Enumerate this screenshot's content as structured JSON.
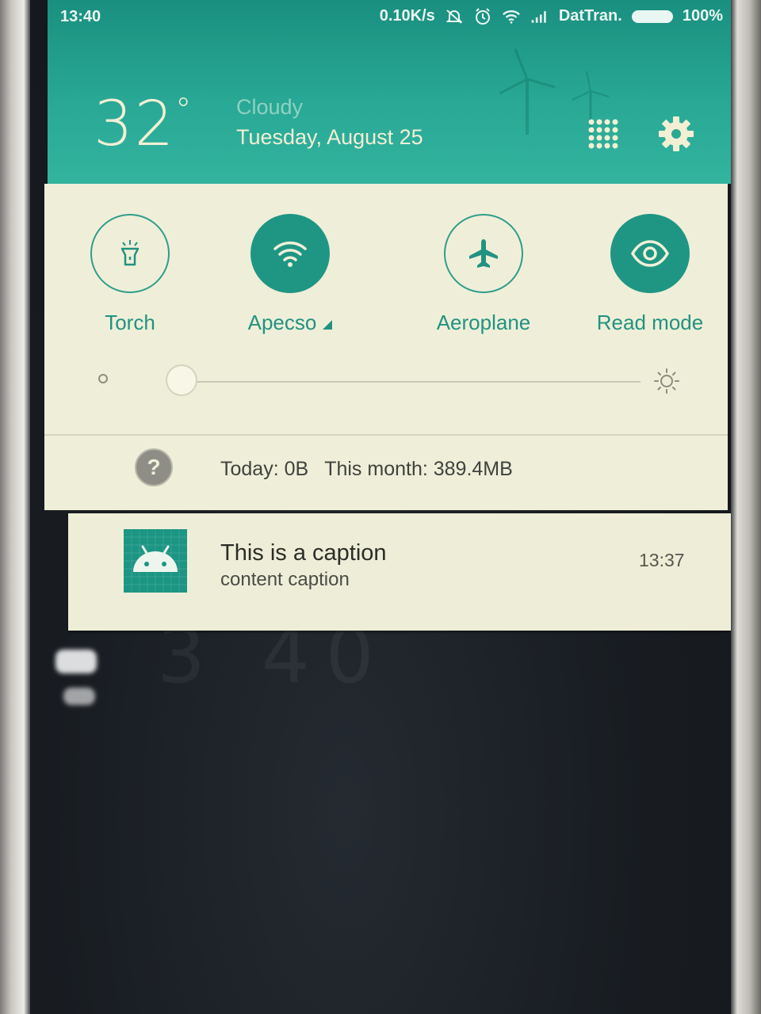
{
  "status_bar": {
    "time": "13:40",
    "network_speed": "0.10K/s",
    "carrier": "DatTran.",
    "battery": "100%"
  },
  "weather": {
    "temperature": "32",
    "degree_symbol": "°",
    "condition": "Cloudy",
    "date": "Tuesday, August 25"
  },
  "quick_toggles": [
    {
      "label": "Torch",
      "state": "off",
      "icon": "flashlight-icon"
    },
    {
      "label": "Apecso",
      "state": "on",
      "icon": "wifi-icon"
    },
    {
      "label": "Aeroplane",
      "state": "off",
      "icon": "airplane-icon"
    },
    {
      "label": "Read mode",
      "state": "on",
      "icon": "eye-icon"
    }
  ],
  "brightness": {
    "level": 0.05
  },
  "data_usage": {
    "today": "Today: 0B",
    "month": "This month: 389.4MB"
  },
  "notification": {
    "title": "This is a caption",
    "body": "content caption",
    "time": "13:37"
  },
  "ghost_clock": "3 40",
  "colors": {
    "accent": "#1f9683",
    "header_top": "#1a8f7f",
    "panel": "#efefd9"
  }
}
